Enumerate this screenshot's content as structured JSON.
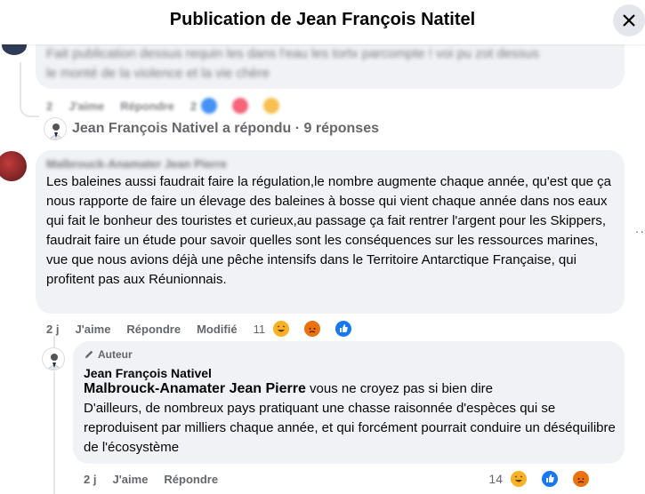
{
  "header": {
    "title": "Publication de Jean François Natitel"
  },
  "prev_comment": {
    "blurred_line1": "Fait publication dessus requin les dans l'eau les tortx parcompte ! voi pu zot dessus",
    "blurred_line2": "le monté de la violence et la vie chère",
    "actions": {
      "time": "2",
      "like": "J'aime",
      "reply": "Répondre",
      "count": "2"
    }
  },
  "replies_link": {
    "text": "Jean François Nativel a répondu · 9 réponses"
  },
  "comment": {
    "author": "Malbrouck-Anamater Jean Pierre",
    "text": "Les baleines aussi faudrait faire la régulation,le nombre augmente chaque année, qu'est que ça nous rapporte de faire un élevage des baleines à bosse qui vient chaque année dans nos eaux qui fait le bonheur des touristes et curieux,au passage ça fait rentrer l'argent pour les Skippers, faudrait faire un étude pour savoir quelles sont les conséquences sur les ressources marines, vue que nous avions déjà une pêche intensifs dans le Territoire Antarctique Française, qui profitent pas aux Réunionnais.",
    "actions": {
      "time": "2 j",
      "like": "J'aime",
      "reply": "Répondre",
      "edited": "Modifié",
      "reaction_count": "11"
    }
  },
  "reply": {
    "badge": "Auteur",
    "author": "Jean François Nativel",
    "mention": "Malbrouck-Anamater Jean Pierre",
    "text_after_mention": " vous ne croyez pas si bien dire",
    "text": "D'ailleurs, de nombreux pays pratiquant une chasse raisonnée d'espèces qui se reproduisent par milliers chaque année, et qui forcément pourrait conduire un déséquilibre de l'écosystème",
    "actions": {
      "time": "2 j",
      "like": "J'aime",
      "reply": "Répondre",
      "reaction_count": "14"
    }
  },
  "more": {
    "dots": "··"
  },
  "colors": {
    "haha": "#f7b125",
    "angry": "#e9710f",
    "like": "#1877f2",
    "love": "#f33e58",
    "bubble": "#f0f2f5"
  }
}
